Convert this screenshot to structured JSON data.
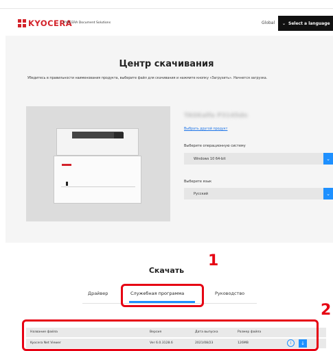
{
  "header": {
    "brand": "KYOCERA",
    "brand_sub": "KYOCERA Document Solutions",
    "global": "Global",
    "language_button": "Select a language"
  },
  "main": {
    "title": "Центр скачивания",
    "intro": "Убедитесь в правильности наименования продукта, выберите файл для скачивания и нажмите кнопку «Загрузить». Начнется загрузка.",
    "model_name": "TASKalfa P3145dn",
    "other_product_link": "Выбрать другой продукт",
    "os_label": "Выберите операционную систему",
    "os_value": "Windows 10 64-bit",
    "language_label": "Выберите язык",
    "language_value": "Русский"
  },
  "download": {
    "title": "Скачать",
    "tabs": [
      {
        "label": "Драйвер"
      },
      {
        "label": "Служебная программа"
      },
      {
        "label": "Руководство"
      }
    ],
    "table": {
      "headers": [
        "Название файла",
        "Версия",
        "Дата выпуска",
        "Размер файла"
      ],
      "rows": [
        [
          "Kyocera Net Viewer",
          "Ver 6.0.3128.6",
          "2021/08/23",
          "126MB"
        ]
      ]
    }
  },
  "callouts": {
    "one": "1",
    "two": "2"
  },
  "colors": {
    "brand_red": "#d3222a",
    "accent_blue": "#1e90ff",
    "callout_red": "#e60012"
  },
  "icons": [
    "chevron-down-icon",
    "info-icon",
    "download-icon"
  ]
}
